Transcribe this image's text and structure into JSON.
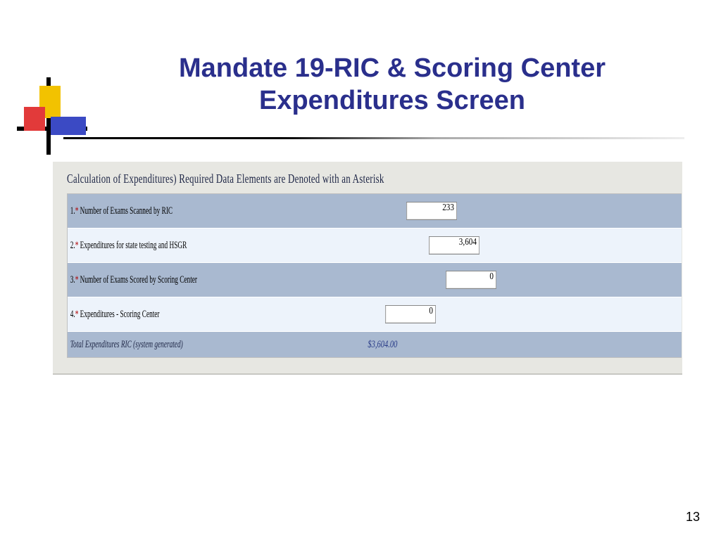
{
  "title": "Mandate 19-RIC & Scoring Center Expenditures Screen",
  "section_title": "Calculation of Expenditures) Required Data Elements are Denoted with an Asterisk",
  "rows": {
    "r1": {
      "label_pre": "1.",
      "label_post": " Number of Exams Scanned by RIC",
      "value": "233"
    },
    "r2": {
      "label_pre": "2.",
      "label_post": " Expenditures for state testing and HSGR",
      "value": "3,604"
    },
    "r3": {
      "label_pre": "3.",
      "label_post": " Number of Exams Scored by Scoring Center",
      "value": "0"
    },
    "r4": {
      "label_pre": "4.",
      "label_post": " Expenditures - Scoring Center",
      "value": "0"
    },
    "total": {
      "label": "Total Expenditures RIC (system generated)",
      "value": "$3,604.00"
    }
  },
  "page_number": "13"
}
